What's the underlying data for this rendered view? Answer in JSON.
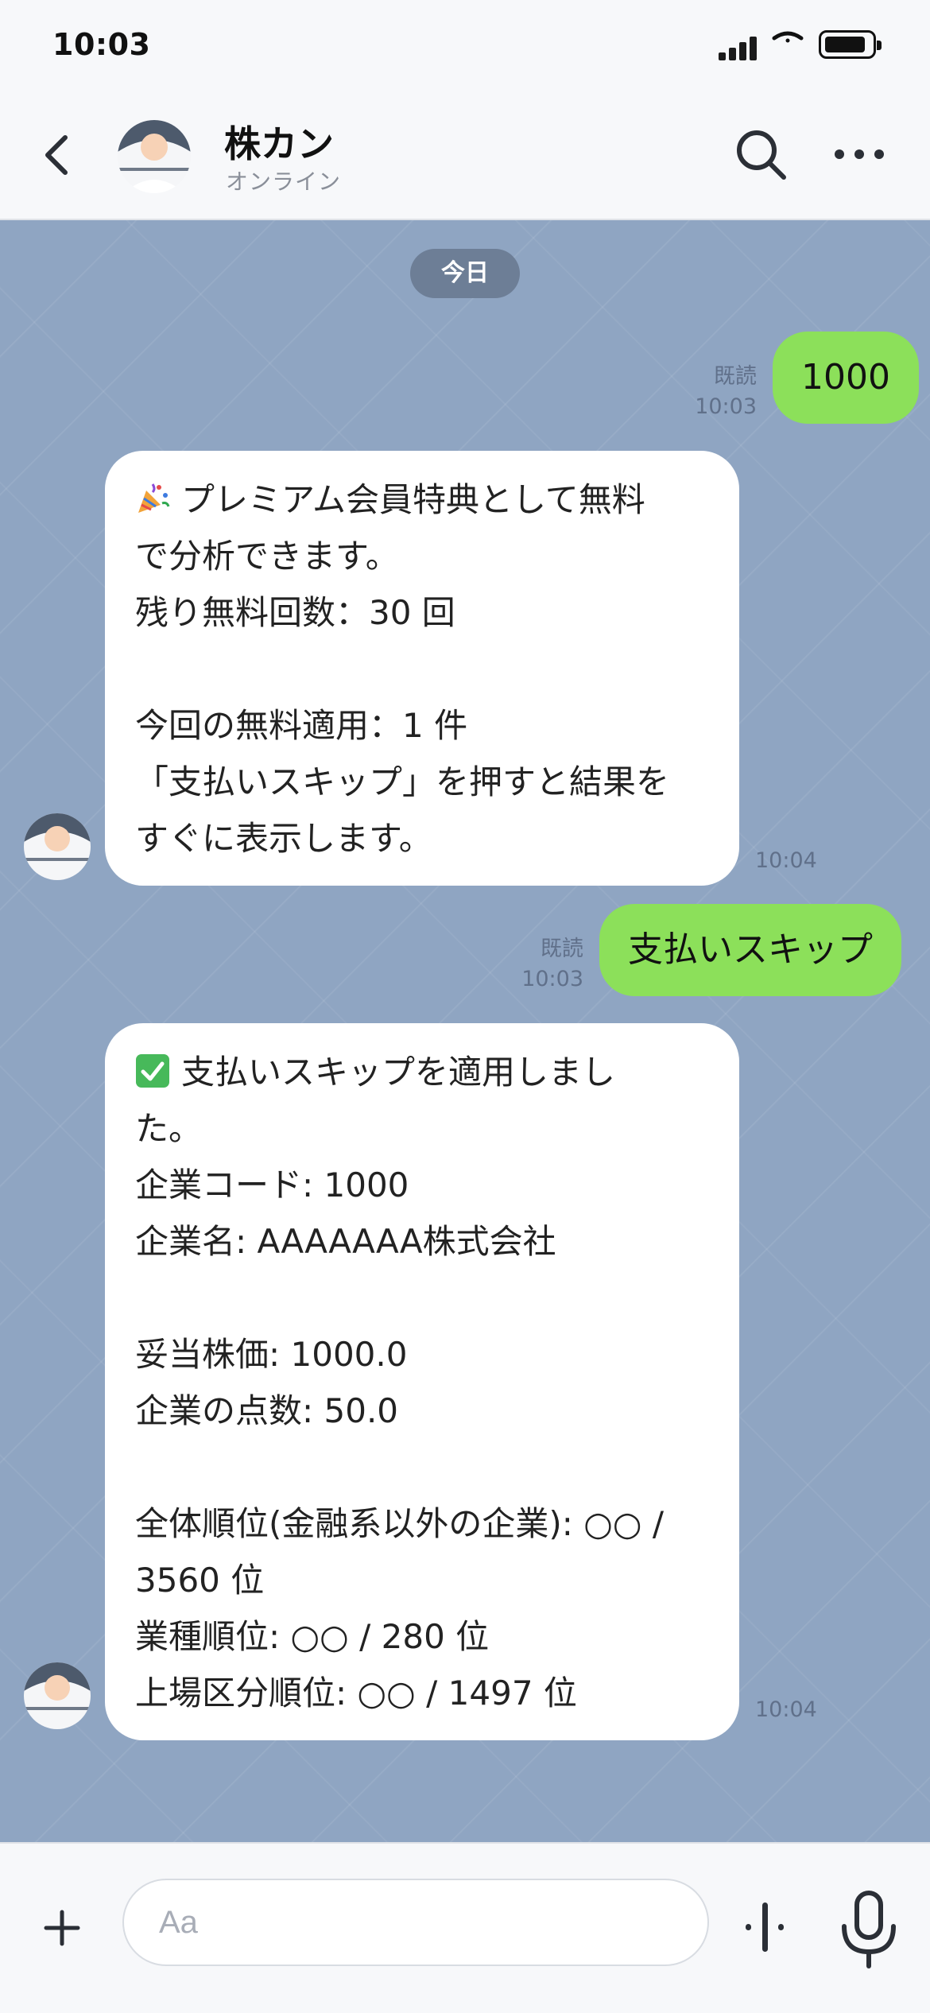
{
  "status_bar": {
    "time": "10:03"
  },
  "header": {
    "name": "株カン",
    "status": "オンライン"
  },
  "chat": {
    "date_label": "今日",
    "messages": [
      {
        "kind": "out",
        "text": "1000",
        "read": "既読",
        "time": "10:03"
      },
      {
        "kind": "in",
        "time": "10:04",
        "emoji": "party-popper-icon",
        "lines": [
          "プレミアム会員特典として無料",
          "で分析できます。",
          "残り無料回数：30 回",
          "",
          "今回の無料適用：1 件",
          "「支払いスキップ」を押すと結果を",
          "すぐに表示します。"
        ]
      },
      {
        "kind": "out",
        "text": "支払いスキップ",
        "read": "既読",
        "time": "10:03"
      },
      {
        "kind": "in",
        "time": "10:04",
        "emoji": "check-mark-icon",
        "lines": [
          "支払いスキップを適用しまし",
          "た。",
          "企業コード: 1000",
          "企業名: AAAAAAA株式会社",
          "",
          "妥当株価: 1000.0",
          "企業の点数: 50.0",
          "",
          "全体順位(金融系以外の企業): ○○ /",
          "3560 位",
          "業種順位: ○○ / 280 位",
          "上場区分順位: ○○ / 1497 位"
        ]
      }
    ]
  },
  "input": {
    "placeholder": "Aa"
  },
  "colors": {
    "chat_bg": "#8FA5C2",
    "out_bubble": "#8CE05A",
    "in_bubble": "#FFFFFF",
    "date_pill": "#6D7E96"
  }
}
